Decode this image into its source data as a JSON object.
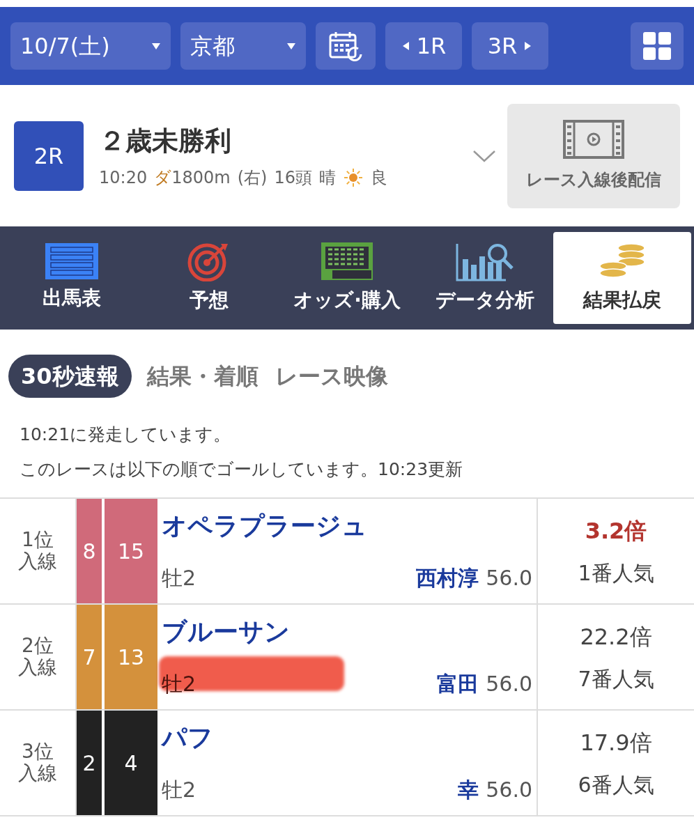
{
  "top_bar": {
    "date": "10/7(土)",
    "venue": "京都",
    "prev_race": "1R",
    "next_race": "3R"
  },
  "race": {
    "number": "2R",
    "title": "２歳未勝利",
    "time": "10:20",
    "surface": "ダ",
    "distance": "1800m",
    "direction": "(右)",
    "runners": "16頭",
    "weather": "晴",
    "going": "良",
    "video_label": "レース入線後配信"
  },
  "nav": [
    {
      "label": "出馬表",
      "selected": false
    },
    {
      "label": "予想",
      "selected": false
    },
    {
      "label": "オッズ·購入",
      "selected": false
    },
    {
      "label": "データ分析",
      "selected": false
    },
    {
      "label": "結果払戻",
      "selected": true
    }
  ],
  "sub_tabs": [
    {
      "label": "30秒速報",
      "selected": true
    },
    {
      "label": "結果・着順",
      "selected": false
    },
    {
      "label": "レース映像",
      "selected": false
    }
  ],
  "notice": [
    "10:21に発走しています。",
    "このレースは以下の順でゴールしています。10:23更新"
  ],
  "results": [
    {
      "place": "1位",
      "status": "入線",
      "frame": "8",
      "number": "15",
      "color": "#d06a7a",
      "horse": "オペラプラージュ",
      "sex_age": "牡2",
      "jockey": "西村淳",
      "weight": "56.0",
      "odds": "3.2倍",
      "popularity": "1番人気",
      "favorite": true,
      "redacted": false
    },
    {
      "place": "2位",
      "status": "入線",
      "frame": "7",
      "number": "13",
      "color": "#d4913c",
      "horse": "ブルーサン",
      "sex_age": "牡2",
      "jockey": "富田",
      "weight": "56.0",
      "odds": "22.2倍",
      "popularity": "7番人気",
      "favorite": false,
      "redacted": true
    },
    {
      "place": "3位",
      "status": "入線",
      "frame": "2",
      "number": "4",
      "color": "#222222",
      "horse": "パフ",
      "sex_age": "牡2",
      "jockey": "幸",
      "weight": "56.0",
      "odds": "17.9倍",
      "popularity": "6番人気",
      "favorite": false,
      "redacted": false
    }
  ]
}
